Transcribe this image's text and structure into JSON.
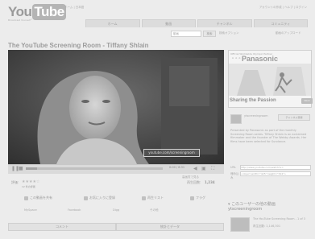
{
  "header": {
    "logo_you": "You",
    "logo_tube": "Tube",
    "logo_tagline": "Broadcast Yourself™",
    "top_left_links": "ホーム | 日本語",
    "top_right_links": "アカウントの作成 | ヘルプ | ログイン",
    "tabs": [
      "ホーム",
      "動画",
      "チャンネル",
      "コミュニティ"
    ],
    "search_placeholder": "動画",
    "search_button": "検索",
    "advanced_search": "検索オプション",
    "upload_link": "動画のアップロード"
  },
  "video": {
    "title": "The YouTube Screening Room - Tiffany Shlain",
    "watermark": "youtube.com/screeningroom",
    "timecode": "0:00 / 8:31",
    "progress": 0.08,
    "quality_label": "高画質で見る",
    "rating_label": "評価:",
    "rating_stars": "★★★★☆",
    "ratings_count": "12 件の評価",
    "view_count_label": "再生回数:",
    "view_count": "1,234",
    "actions": [
      "この動画を共有",
      "お気に入りに登録",
      "再生リスト",
      "フラグ"
    ],
    "share_targets": [
      "MySpace",
      "Facebook",
      "Digg",
      "その他"
    ]
  },
  "comments": {
    "tabs": [
      "コメント",
      "統計とデータ"
    ]
  },
  "ad": {
    "sponsor": "Official Worldwide Olympic Partner",
    "brand": "Panasonic",
    "caption": "Sharing the Passion",
    "click_label": "Click"
  },
  "sidebar": {
    "channel_name": "ytscreeningroom",
    "subscribe_label": "チャンネル登録",
    "description": "Presented by Panasonic as part of the monthly Screening Room series. Tiffany Shlain is an acclaimed filmmaker and the founder of The Webby Awards. Her films have been selected for Sundance.",
    "url_label": "URL",
    "url_value": "http://www.youtube.com/watch?v=",
    "embed_label": "埋め込み",
    "embed_value": "<object width=\"425\" height=\"344\">",
    "more_header": "このユーザーの他の動画",
    "more_channel": "ytscreeningroom",
    "more_video_title": "The YouTube Screening Room - 1 of 3",
    "more_video_meta": "再生回数: 1,146,301"
  }
}
